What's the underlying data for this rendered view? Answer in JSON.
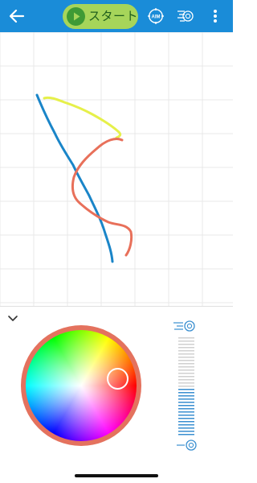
{
  "toolbar": {
    "start_label": "スタート",
    "aim_label": "AIM",
    "icons": [
      "back-arrow-icon",
      "play-icon",
      "aim-icon",
      "speed-icon",
      "more-vertical-icon"
    ]
  },
  "drawing": {
    "stroke_colors": [
      "#1a85c8",
      "#e6f04a",
      "#e8705a"
    ],
    "grid": true
  },
  "color_panel": {
    "selected_color": "#e4725e",
    "speed_level": 0.5,
    "icons": [
      "chevron-down-icon",
      "speed-fast-icon",
      "speed-slow-icon"
    ]
  },
  "colors": {
    "header": "#1a8cd8",
    "start_button": "#a6d55a",
    "play": "#3f9a35",
    "accent": "#3a8fd0"
  }
}
